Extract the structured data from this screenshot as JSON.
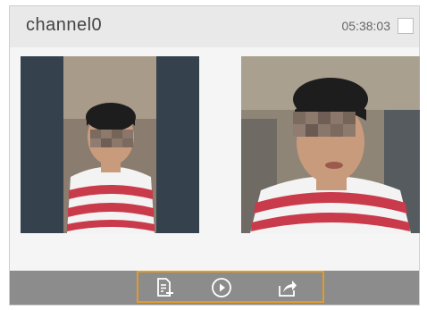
{
  "header": {
    "channel_name": "channel0",
    "timestamp": "05:38:03"
  },
  "thumbnails": [
    {
      "name": "snapshot-left"
    },
    {
      "name": "snapshot-right"
    }
  ],
  "toolbar": {
    "buttons": [
      {
        "icon": "add-document-icon"
      },
      {
        "icon": "play-icon"
      },
      {
        "icon": "export-icon"
      }
    ],
    "highlight_color": "#e39a28"
  }
}
